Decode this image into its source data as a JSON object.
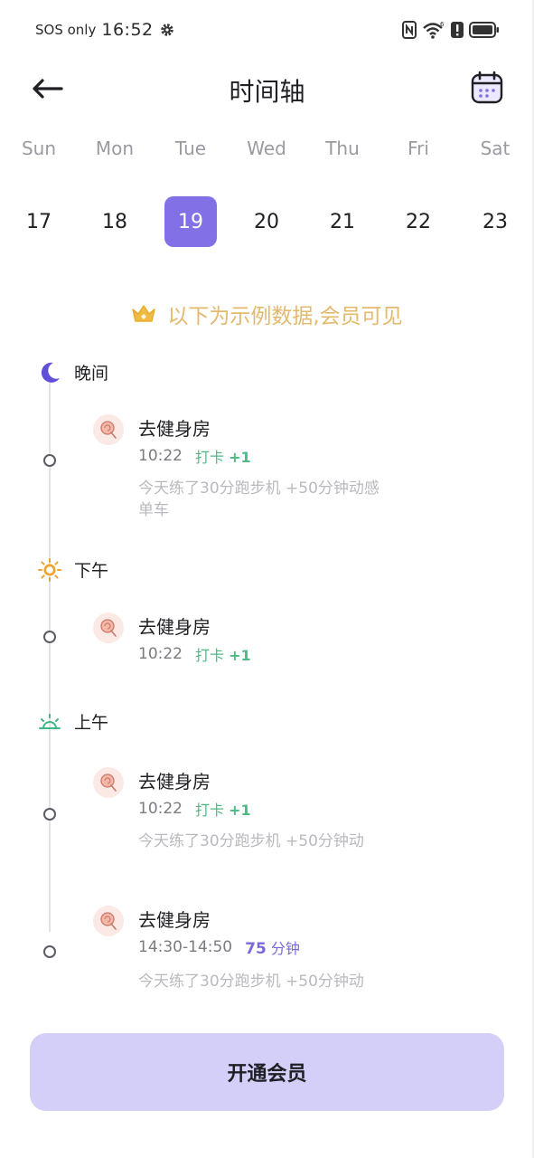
{
  "status_bar": {
    "carrier": "SOS only",
    "time": "16:52"
  },
  "header": {
    "title": "时间轴"
  },
  "week": {
    "days": [
      "Sun",
      "Mon",
      "Tue",
      "Wed",
      "Thu",
      "Fri",
      "Sat"
    ],
    "dates": [
      "17",
      "18",
      "19",
      "20",
      "21",
      "22",
      "23"
    ],
    "selected_index": 2
  },
  "banner": {
    "text": "以下为示例数据,会员可见"
  },
  "sections": [
    {
      "label": "晚间",
      "icon": "moon-icon"
    },
    {
      "label": "下午",
      "icon": "sun-icon"
    },
    {
      "label": "上午",
      "icon": "sunrise-icon"
    }
  ],
  "entries": [
    {
      "title": "去健身房",
      "time": "10:22",
      "checkin_label": "打卡",
      "checkin_count": "+1",
      "note": "今天练了30分跑步机 +50分钟动感单车"
    },
    {
      "title": "去健身房",
      "time": "10:22",
      "checkin_label": "打卡",
      "checkin_count": "+1"
    },
    {
      "title": "去健身房",
      "time": "10:22",
      "checkin_label": "打卡",
      "checkin_count": "+1",
      "note": "今天练了30分跑步机 +50分钟动"
    },
    {
      "title": "去健身房",
      "time": "14:30-14:50",
      "duration_value": "75",
      "duration_unit": "分钟",
      "note": "今天练了30分跑步机 +50分钟动"
    }
  ],
  "cta": {
    "label": "开通会员"
  },
  "colors": {
    "accent": "#8170e6",
    "checkin": "#4cbb85",
    "banner": "#e3b96e",
    "cta_bg": "#d3cff8"
  }
}
